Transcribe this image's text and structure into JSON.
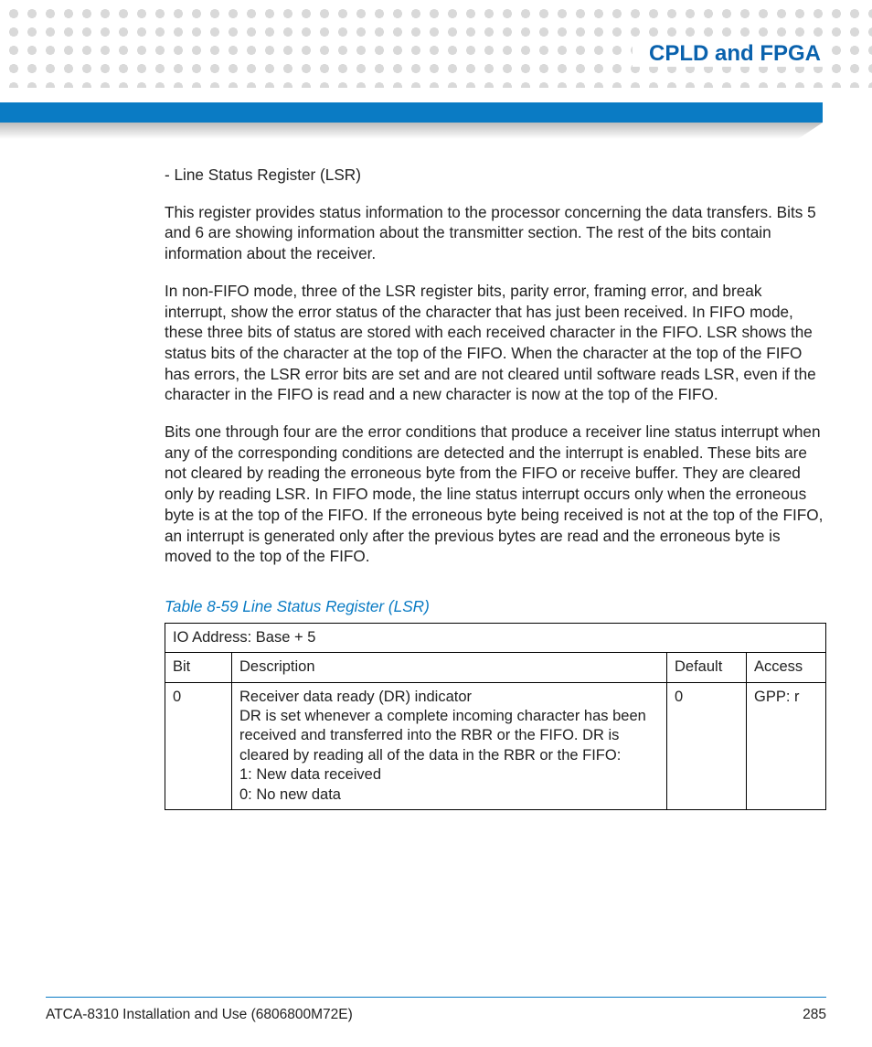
{
  "header": {
    "chapter_title": "CPLD and FPGA"
  },
  "body": {
    "p1": "- Line Status Register (LSR)",
    "p2": "This register provides status information to the processor concerning the data transfers. Bits 5 and 6 are showing information about the transmitter section. The rest of the bits contain information about the receiver.",
    "p3": "In non-FIFO mode, three of the LSR register bits, parity error, framing error, and break interrupt, show the error status of the character that has just been received. In FIFO mode, these three bits of status are stored with each received character in the FIFO. LSR shows the status bits of the character at the top of the FIFO. When the character at the top of the FIFO has errors, the LSR error bits are set and are not cleared until software reads LSR, even if the character in the FIFO is read and a new character is now at the top of the FIFO.",
    "p4": "Bits one through four are the error conditions that produce a receiver line status interrupt when any of the corresponding conditions are detected and the interrupt is enabled. These bits are not cleared by reading the erroneous byte from the FIFO or receive buffer. They are cleared only by reading LSR. In FIFO mode, the line status interrupt occurs only when the erroneous byte is at the top of the FIFO. If the erroneous byte being received is not at the top of the FIFO, an interrupt is generated only after the previous bytes are read and the erroneous byte is moved to the top of the FIFO."
  },
  "table": {
    "caption": "Table 8-59 Line Status Register (LSR)",
    "io_address": "IO Address: Base + 5",
    "headers": {
      "bit": "Bit",
      "description": "Description",
      "default": "Default",
      "access": "Access"
    },
    "row0": {
      "bit": "0",
      "desc_line1": "Receiver data ready (DR) indicator",
      "desc_line2": "DR is set whenever a complete incoming character has been received and transferred into the RBR or the FIFO. DR is cleared by reading all of the data in the RBR or the FIFO:",
      "desc_line3": "1: New data received",
      "desc_line4": "0: No new data",
      "default": "0",
      "access": "GPP: r"
    }
  },
  "footer": {
    "doc_title": "ATCA-8310 Installation and Use (6806800M72E)",
    "page_number": "285"
  }
}
